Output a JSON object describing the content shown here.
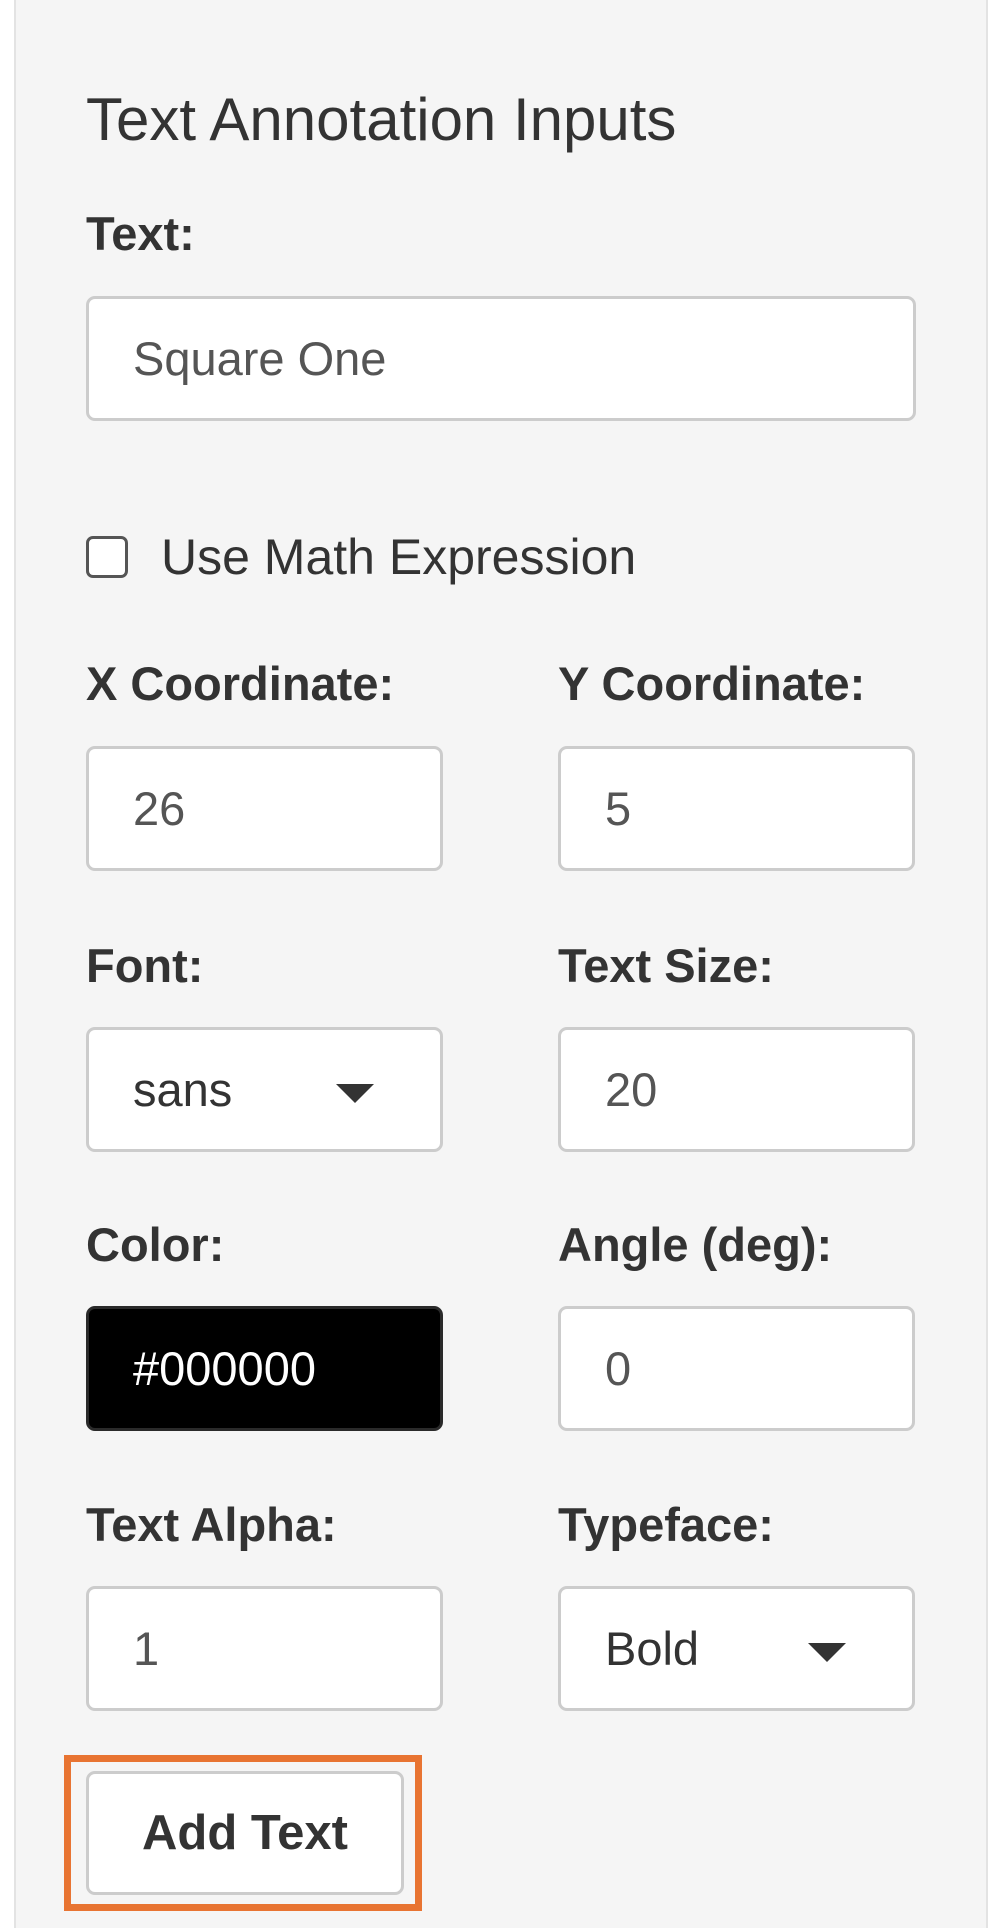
{
  "panel": {
    "heading": "Text Annotation Inputs"
  },
  "text_input": {
    "label": "Text:",
    "value": "Square One"
  },
  "math_expression": {
    "label": "Use Math Expression",
    "checked": false
  },
  "x_coordinate": {
    "label": "X Coordinate:",
    "value": "26"
  },
  "y_coordinate": {
    "label": "Y Coordinate:",
    "value": "5"
  },
  "font": {
    "label": "Font:",
    "selected": "sans",
    "icon": "chevron-down-icon"
  },
  "text_size": {
    "label": "Text Size:",
    "value": "20"
  },
  "color": {
    "label": "Color:",
    "value": "#000000",
    "swatch": "#000000"
  },
  "angle": {
    "label": "Angle (deg):",
    "value": "0"
  },
  "text_alpha": {
    "label": "Text Alpha:",
    "value": "1"
  },
  "typeface": {
    "label": "Typeface:",
    "selected": "Bold",
    "icon": "chevron-down-icon"
  },
  "add_button": {
    "label": "Add Text",
    "highlight_color": "#e87432"
  }
}
